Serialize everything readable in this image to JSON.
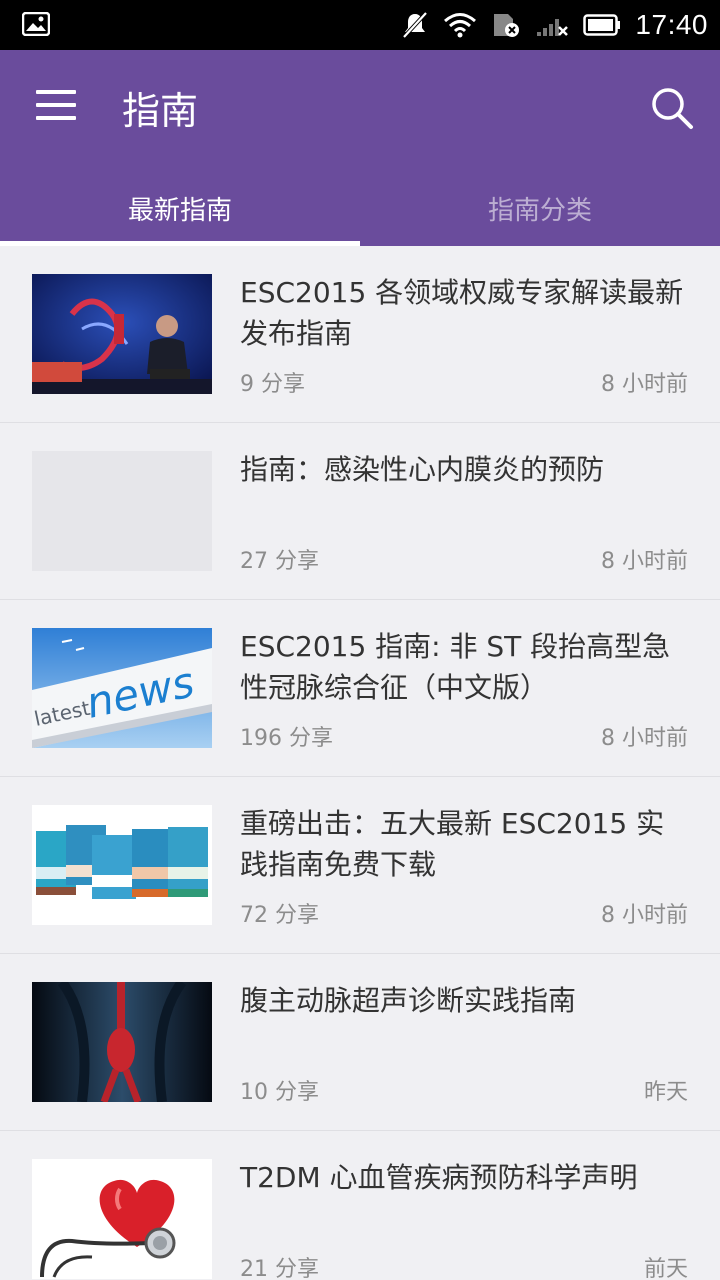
{
  "status_bar": {
    "time": "17:40"
  },
  "app_bar": {
    "title": "指南"
  },
  "tabs": [
    {
      "label": "最新指南",
      "active": true
    },
    {
      "label": "指南分类",
      "active": false
    }
  ],
  "articles": [
    {
      "title": "ESC2015 各领域权威专家解读最新发布指南",
      "shares": "9 分享",
      "time": "8 小时前",
      "thumb": "conference-stage-image"
    },
    {
      "title": "指南：感染性心内膜炎的预防",
      "shares": "27 分享",
      "time": "8 小时前",
      "thumb": "placeholder-image"
    },
    {
      "title": "ESC2015 指南: 非 ST 段抬高型急性冠脉综合征（中文版）",
      "shares": "196 分享",
      "time": "8 小时前",
      "thumb": "latest-news-image"
    },
    {
      "title": "重磅出击：五大最新 ESC2015 实践指南免费下载",
      "shares": "72 分享",
      "time": "8 小时前",
      "thumb": "guideline-booklets-image"
    },
    {
      "title": "腹主动脉超声诊断实践指南",
      "shares": "10 分享",
      "time": "昨天",
      "thumb": "aorta-anatomy-image"
    },
    {
      "title": "T2DM 心血管疾病预防科学声明",
      "shares": "21 分享",
      "time": "前天",
      "thumb": "heart-stethoscope-image"
    }
  ],
  "colors": {
    "primary": "#6a4c9c",
    "background": "#f0f0f3",
    "meta_text": "#8c8c8c"
  }
}
